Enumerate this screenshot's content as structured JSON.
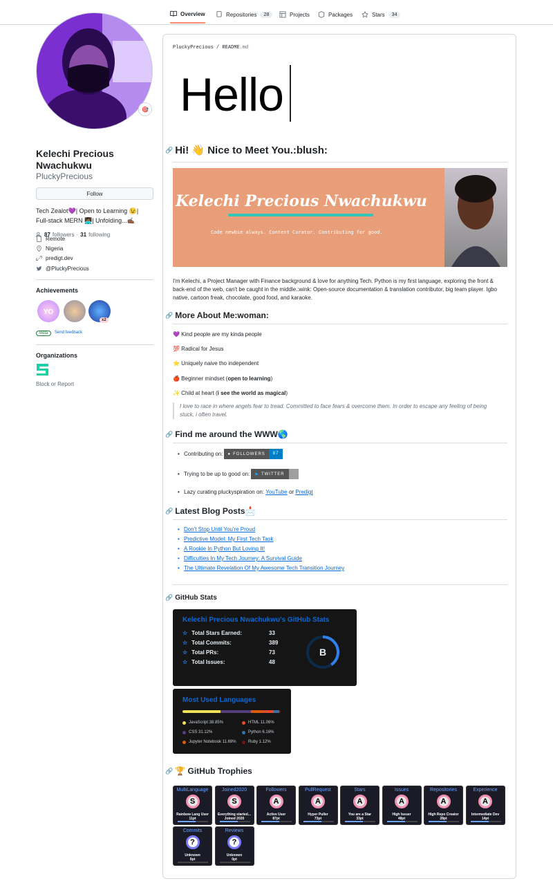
{
  "tabs": [
    {
      "label": "Overview"
    },
    {
      "label": "Repositories",
      "count": "28"
    },
    {
      "label": "Projects"
    },
    {
      "label": "Packages"
    },
    {
      "label": "Stars",
      "count": "34"
    }
  ],
  "profile": {
    "name": "Kelechi Precious Nwachukwu",
    "login": "PluckyPrecious",
    "follow": "Follow",
    "bio_line1": "Tech Zealot💜| Open to Learning 😉|",
    "bio_line2": "Full-stack MERN 👩🏾‍💻| Unfolding...✍🏾",
    "followers_count": "87",
    "followers_label": "followers",
    "dot": "·",
    "following_count": "31",
    "following_label": "following",
    "work": "Remote",
    "location": "Nigeria",
    "site": "predigt.dev",
    "twitter": "@PluckyPrecious",
    "achievements_title": "Achievements",
    "badge_x2": "x2",
    "beta": "Beta",
    "feedback": "Send feedback",
    "orgs_title": "Organizations",
    "block": "Block or Report"
  },
  "readme": {
    "crumb_user": "PluckyPrecious",
    "crumb_sep": "/",
    "crumb_file": "README",
    "crumb_ext": ".md",
    "hello": "Hello",
    "h_hi": "Hi! 👋 Nice to Meet You.:blush:",
    "banner_title": "Kelechi Precious Nwachukwu",
    "banner_sub": "Code newbie always. Content Curator. Contributing for good.",
    "intro": "I'm Kelechi, a Project Manager with Finance background & love for anything Tech. Python is my first language, exploring the front & back-end of the web, can't be caught in the middle.:wink: Open-source documentation & translation contributor, big team player. Igbo native, cartoon freak, chocolate, good food, and karaoke.",
    "h_more": "More About Me:woman:",
    "more": [
      "💜 Kind people are my kinda people",
      "💯 Radical for Jesus",
      "⭐ Uniquely naive tho independent"
    ],
    "more4_a": "🍎 Beginner mindset (",
    "more4_b": "open to learning",
    "more4_c": ")",
    "more5_a": "✨ Child at heart (",
    "more5_b": "i see the world as magical",
    "more5_c": ")",
    "quote": "I love to race in where angels fear to tread. Committed to face fears & overcome them. In order to escape any feeling of being stuck, i often travel.",
    "h_find": "Find me around the WWW🌎",
    "find1": "Contributing on:",
    "gh_shield": "FOLLOWERS",
    "gh_count": "87",
    "find2": "Trying to be up to good on:",
    "tw_shield": "TWITTER",
    "find3": "Lazy curating pluckyspiration on:",
    "yt": "YouTube",
    "or": "or",
    "predigt": "Predigt",
    "h_blog": "Latest Blog Posts📩",
    "posts": [
      "Don't Stop Until You're Proud",
      "Predictive Model: My First Tech Task",
      "A Rookie In Python But Loving It!",
      "Difficulties In My Tech Journey: A Survival Guide",
      "The Ultimate Revelation Of My Awesome Tech Transition Journey"
    ],
    "h_stats": "GitHub Stats",
    "stats": {
      "title": "Kelechi Precious Nwachukwu's GitHub Stats",
      "rows": [
        {
          "label": "Total Stars Earned:",
          "value": "33"
        },
        {
          "label": "Total Commits:",
          "value": "389"
        },
        {
          "label": "Total PRs:",
          "value": "73"
        },
        {
          "label": "Total Issues:",
          "value": "48"
        }
      ],
      "grade": "B"
    },
    "langs": {
      "title": "Most Used Languages",
      "items": [
        {
          "name": "JavaScript 38.85%",
          "color": "#f1e05a",
          "pct": 38.85
        },
        {
          "name": "HTML 11.06%",
          "color": "#e34c26",
          "pct": 11.06
        },
        {
          "name": "CSS 31.12%",
          "color": "#563d7c",
          "pct": 31.12
        },
        {
          "name": "Python 6.16%",
          "color": "#3572A5",
          "pct": 6.16
        },
        {
          "name": "Jupyter Notebook 11.69%",
          "color": "#DA5B0B",
          "pct": 11.69
        },
        {
          "name": "Ruby 1.12%",
          "color": "#701516",
          "pct": 1.12
        }
      ]
    },
    "h_trophy": "🏆 GitHub Trophies",
    "trophies": [
      {
        "title": "MultiLanguage",
        "rank": "S",
        "l1": "Rainbow Lang User",
        "l2": "11pt"
      },
      {
        "title": "Joined2020",
        "rank": "S",
        "l1": "Everything started...",
        "l2": "Joined 2020"
      },
      {
        "title": "Followers",
        "rank": "A",
        "l1": "Active User",
        "l2": "87pt"
      },
      {
        "title": "PullRequest",
        "rank": "A",
        "l1": "Hyper Puller",
        "l2": "73pt"
      },
      {
        "title": "Stars",
        "rank": "A",
        "l1": "You are a Star",
        "l2": "33pt"
      },
      {
        "title": "Issues",
        "rank": "A",
        "l1": "High Issuer",
        "l2": "48pt"
      },
      {
        "title": "Repositories",
        "rank": "A",
        "l1": "High Repo Creator",
        "l2": "28pt"
      },
      {
        "title": "Experience",
        "rank": "A",
        "l1": "Intermediate Dev",
        "l2": "14pt"
      },
      {
        "title": "Commits",
        "rank": "?",
        "l1": "Unknown",
        "l2": "0pt"
      },
      {
        "title": "Reviews",
        "rank": "?",
        "l1": "Unknown",
        "l2": "0pt"
      }
    ]
  }
}
